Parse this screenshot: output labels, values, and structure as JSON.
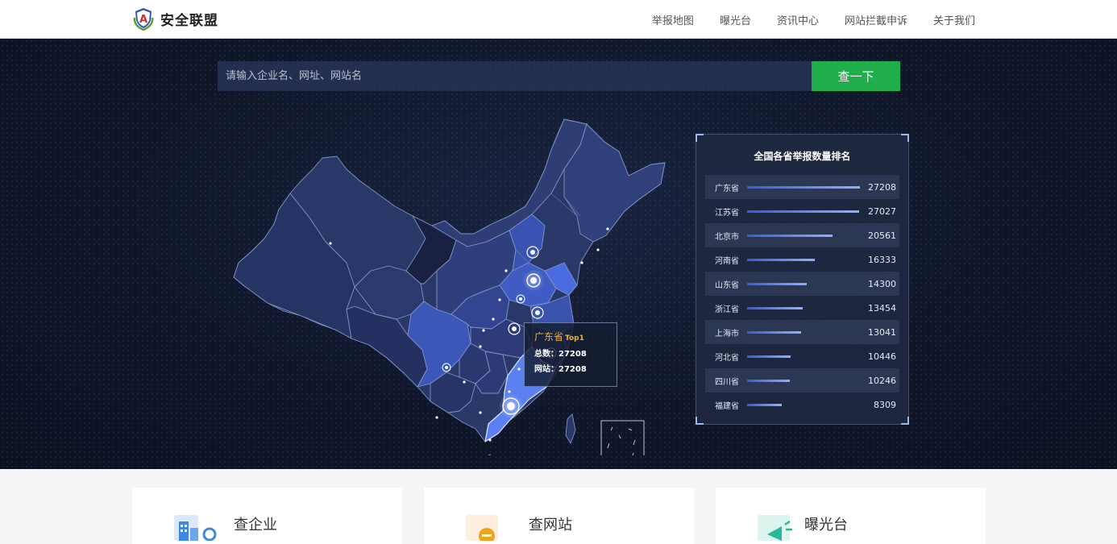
{
  "header": {
    "logo_text": "安全联盟",
    "nav": [
      "举报地图",
      "曝光台",
      "资讯中心",
      "网站拦截申诉",
      "关于我们"
    ]
  },
  "search": {
    "placeholder": "请输入企业名、网址、网站名",
    "button": "查一下"
  },
  "tooltip": {
    "province": "广东省",
    "rank": "Top1",
    "total": "总数：27208",
    "sites": "网站：27208"
  },
  "ranking": {
    "title": "全国各省举报数量排名",
    "items": [
      {
        "name": "广东省",
        "value": 27208
      },
      {
        "name": "江苏省",
        "value": 27027
      },
      {
        "name": "北京市",
        "value": 20561
      },
      {
        "name": "河南省",
        "value": 16333
      },
      {
        "name": "山东省",
        "value": 14300
      },
      {
        "name": "浙江省",
        "value": 13454
      },
      {
        "name": "上海市",
        "value": 13041
      },
      {
        "name": "河北省",
        "value": 10446
      },
      {
        "name": "四川省",
        "value": 10246
      },
      {
        "name": "福建省",
        "value": 8309
      }
    ]
  },
  "cards": [
    "查企业",
    "查网站",
    "曝光台"
  ],
  "colors": {
    "accent_green": "#1fae4b",
    "hero_bg": "#0f1629",
    "map_fill": "#2a3a78",
    "highlight": "#4a72e8"
  }
}
